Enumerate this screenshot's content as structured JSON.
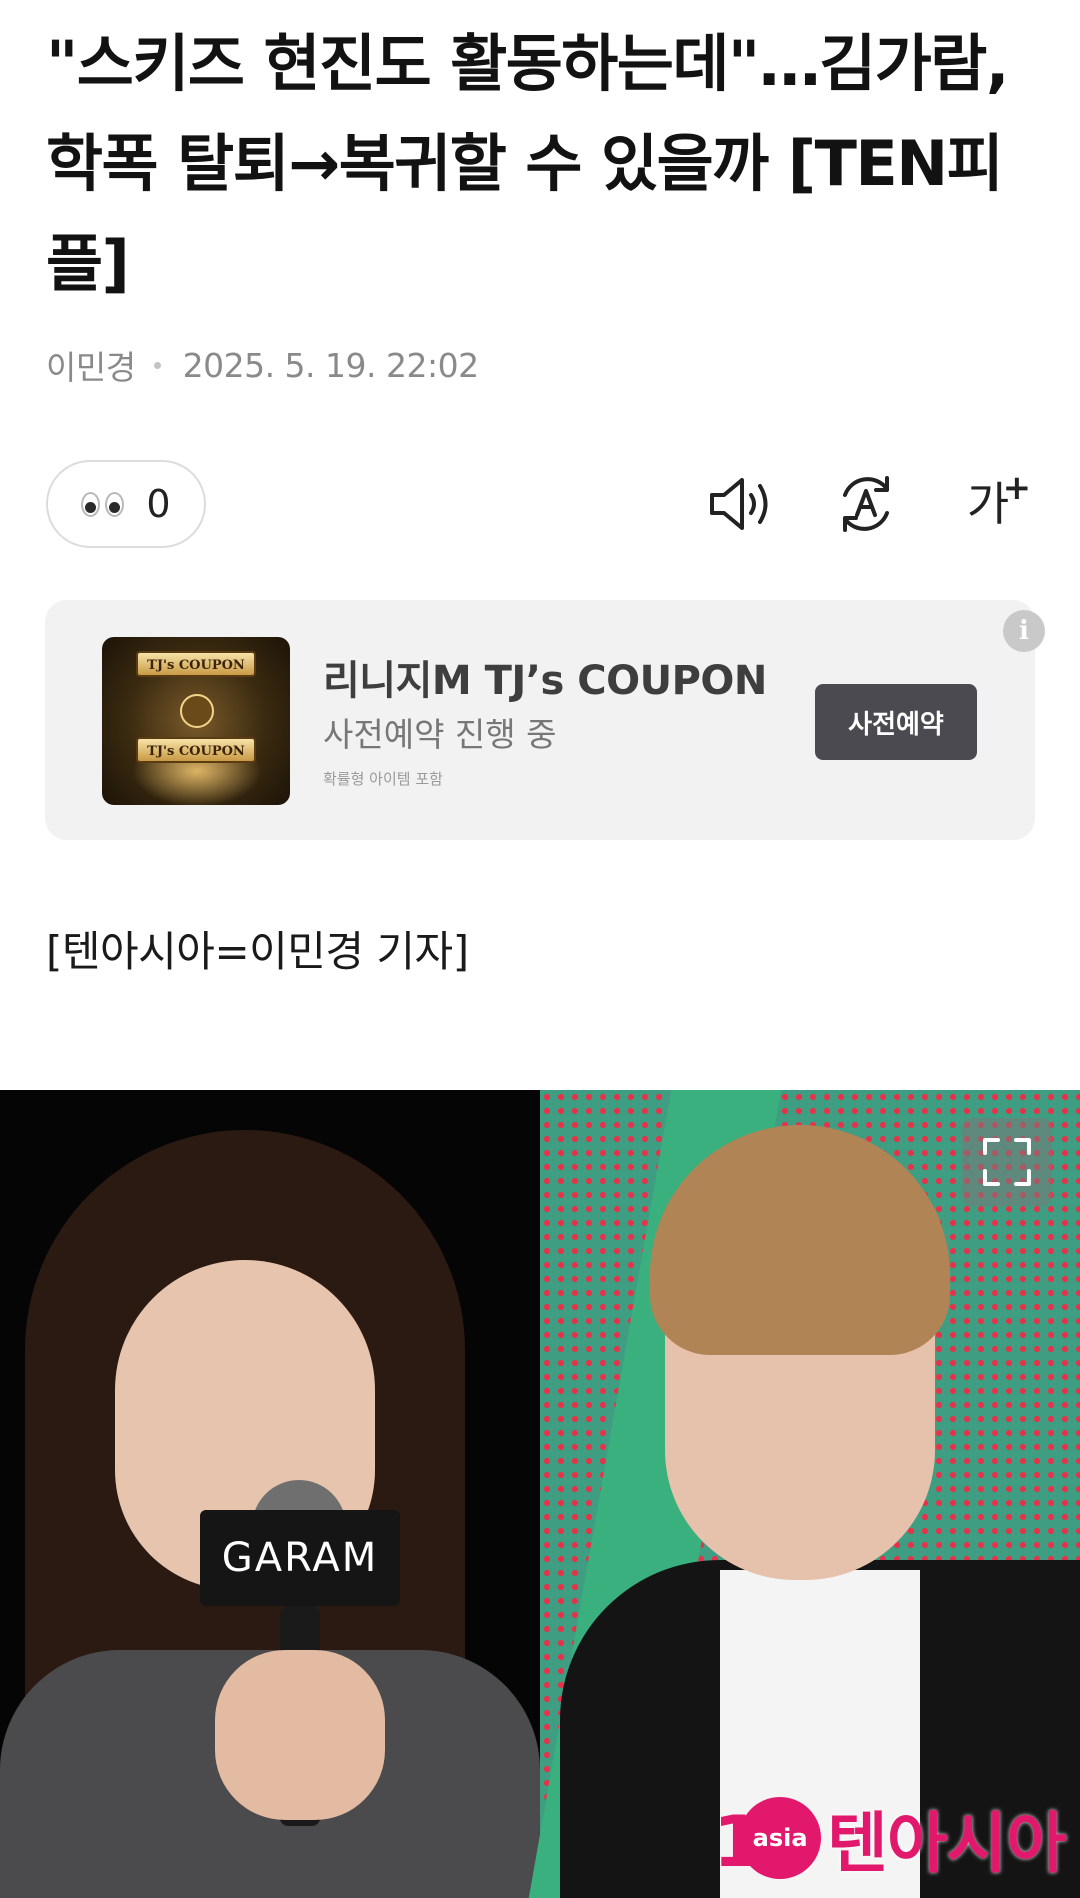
{
  "article": {
    "headline": "\"스키즈 현진도 활동하는데\"…김가람, 학폭 탈퇴→복귀할 수 있을까 [TEN피플]",
    "author": "이민경",
    "datetime": "2025. 5. 19. 22:02",
    "reaction_count": "0",
    "body_first_line": "[텐아시아=이민경 기자]"
  },
  "toolbar": {
    "icons": [
      "eyes-emoji",
      "speaker-icon",
      "translate-icon",
      "font-size-icon"
    ],
    "font_size_label": "가",
    "font_size_plus": "+"
  },
  "ad": {
    "title": "리니지M TJ’s COUPON",
    "subtitle": "사전예약 진행 중",
    "note": "확률형 아이템 포함",
    "cta_label": "사전예약",
    "info_label": "i",
    "image_text_top": "TJ's COUPON",
    "image_text_bottom": "TJ's COUPON"
  },
  "photo": {
    "mic_flag_text": "GARAM",
    "watermark_badge": "asia",
    "watermark_one": "1",
    "watermark_text": "텐아시아"
  },
  "colors": {
    "text": "#121212",
    "meta": "#8a8a8a",
    "ad_bg": "#f2f2f2",
    "cta_bg": "#4a4a50",
    "brand_pink": "#e2186d"
  }
}
